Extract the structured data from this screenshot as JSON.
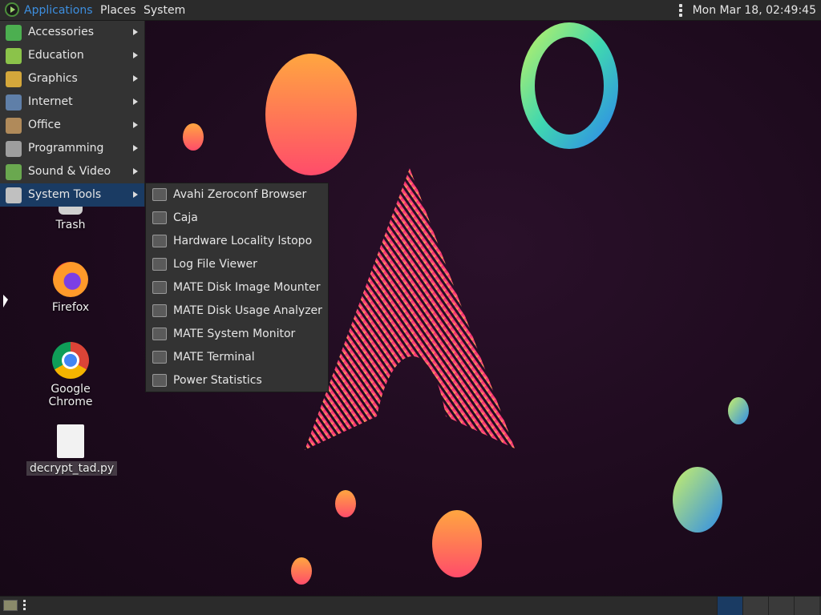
{
  "top_panel": {
    "applications": "Applications",
    "places": "Places",
    "system": "System",
    "clock": "Mon Mar 18, 02:49:45"
  },
  "app_menu": {
    "categories": [
      {
        "label": "Accessories",
        "icon": "accessories-icon",
        "color": "#4caf50"
      },
      {
        "label": "Education",
        "icon": "education-icon",
        "color": "#8bc34a"
      },
      {
        "label": "Graphics",
        "icon": "graphics-icon",
        "color": "#d4a73b"
      },
      {
        "label": "Internet",
        "icon": "internet-icon",
        "color": "#5f7fa8"
      },
      {
        "label": "Office",
        "icon": "office-icon",
        "color": "#b08a5a"
      },
      {
        "label": "Programming",
        "icon": "programming-icon",
        "color": "#9e9e9e"
      },
      {
        "label": "Sound & Video",
        "icon": "sound-video-icon",
        "color": "#6aa84f"
      },
      {
        "label": "System Tools",
        "icon": "system-tools-icon",
        "color": "#c0c0c0"
      }
    ],
    "selected": "System Tools"
  },
  "submenu": {
    "items": [
      {
        "label": "Avahi Zeroconf Browser",
        "icon": "avahi-browser-icon"
      },
      {
        "label": "Caja",
        "icon": "caja-file-manager-icon"
      },
      {
        "label": "Hardware Locality lstopo",
        "icon": "hardware-locality-icon"
      },
      {
        "label": "Log File Viewer",
        "icon": "log-viewer-icon"
      },
      {
        "label": "MATE Disk Image Mounter",
        "icon": "disk-image-mounter-icon"
      },
      {
        "label": "MATE Disk Usage Analyzer",
        "icon": "disk-usage-analyzer-icon"
      },
      {
        "label": "MATE System Monitor",
        "icon": "system-monitor-icon"
      },
      {
        "label": "MATE Terminal",
        "icon": "terminal-icon"
      },
      {
        "label": "Power Statistics",
        "icon": "power-statistics-icon"
      }
    ]
  },
  "desktop_icons": {
    "trash": "Trash",
    "firefox": "Firefox",
    "chrome": "Google Chrome",
    "file": "decrypt_tad.py"
  },
  "colors": {
    "panel": "#2b2b2b",
    "menu_bg": "#333333",
    "selection": "#1a3b63",
    "accent": "#3d8fe0"
  }
}
